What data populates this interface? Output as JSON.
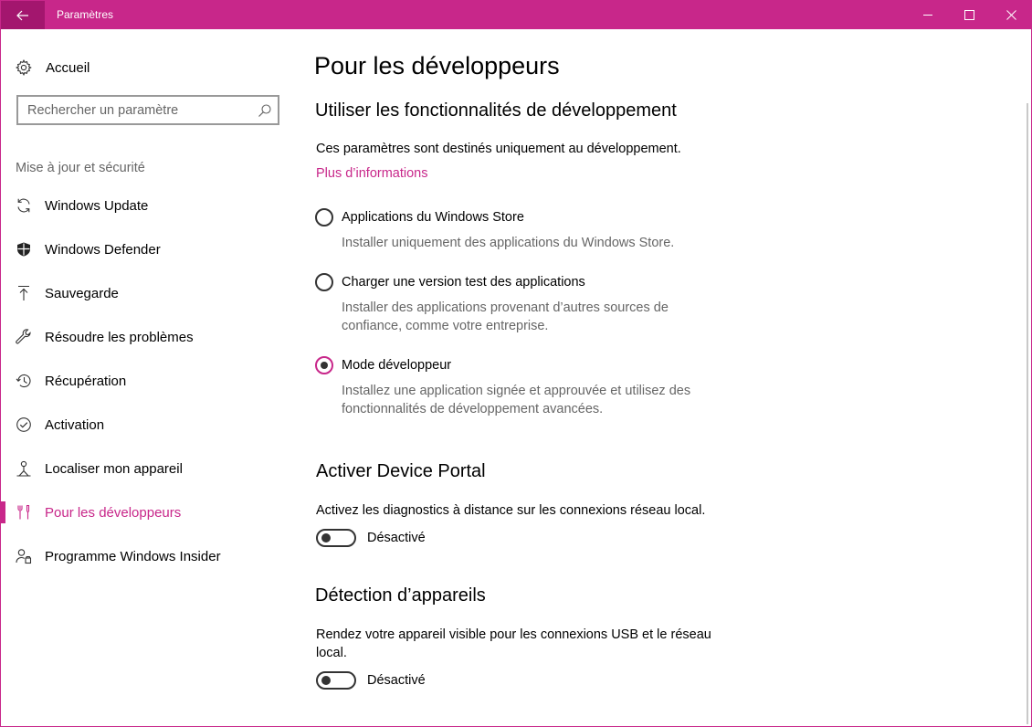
{
  "window": {
    "title": "Paramètres",
    "accent": "#c8278a"
  },
  "sidebar": {
    "home_label": "Accueil",
    "search_placeholder": "Rechercher un paramètre",
    "group_label": "Mise à jour et sécurité",
    "items": [
      {
        "label": "Windows Update",
        "icon": "sync-icon"
      },
      {
        "label": "Windows Defender",
        "icon": "shield-icon"
      },
      {
        "label": "Sauvegarde",
        "icon": "backup-arrow-icon"
      },
      {
        "label": "Résoudre les problèmes",
        "icon": "wrench-icon"
      },
      {
        "label": "Récupération",
        "icon": "history-icon"
      },
      {
        "label": "Activation",
        "icon": "check-circle-icon"
      },
      {
        "label": "Localiser mon appareil",
        "icon": "person-location-icon"
      },
      {
        "label": "Pour les développeurs",
        "icon": "developer-tools-icon",
        "active": true
      },
      {
        "label": "Programme Windows Insider",
        "icon": "insider-icon"
      }
    ]
  },
  "main": {
    "page_title": "Pour les développeurs",
    "dev_section": {
      "title": "Utiliser les fonctionnalités de développement",
      "description": "Ces paramètres sont destinés uniquement au développement.",
      "more_info_link": "Plus d’informations",
      "options": [
        {
          "label": "Applications du Windows Store",
          "description": "Installer uniquement des applications du Windows Store.",
          "checked": false
        },
        {
          "label": "Charger une version test des applications",
          "description": "Installer des applications provenant d’autres sources de confiance, comme votre entreprise.",
          "checked": false
        },
        {
          "label": "Mode développeur",
          "description": "Installez une application signée et approuvée et utilisez des fonctionnalités de développement avancées.",
          "checked": true
        }
      ]
    },
    "device_portal": {
      "title": "Activer Device Portal",
      "description": "Activez les diagnostics à distance sur les connexions réseau local.",
      "toggle_state": "Désactivé"
    },
    "device_discovery": {
      "title": "Détection d’appareils",
      "description": "Rendez votre appareil visible pour les connexions USB et le réseau local.",
      "toggle_state": "Désactivé"
    }
  }
}
